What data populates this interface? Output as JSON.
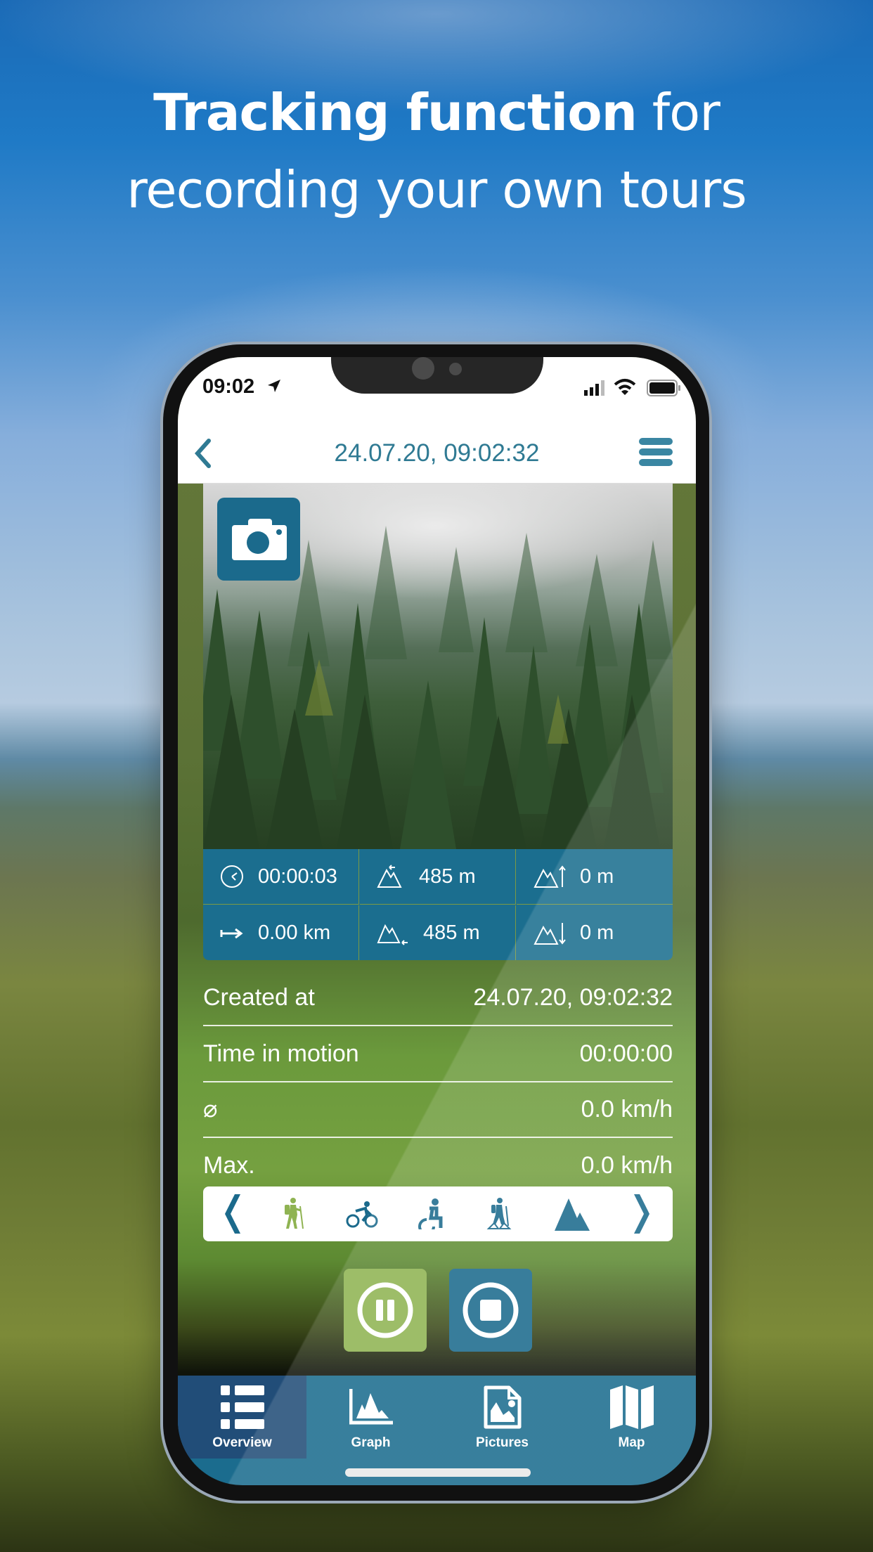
{
  "headline": {
    "line1_bold": "Tracking function",
    "line1_rest": " for",
    "line2": "recording your own tours"
  },
  "status_bar": {
    "time": "09:02",
    "icons": [
      "location-arrow-icon",
      "signal-icon",
      "wifi-icon",
      "battery-icon"
    ]
  },
  "nav": {
    "title": "24.07.20, 09:02:32",
    "back_icon": "chevron-left-icon",
    "menu_icon": "hamburger-menu-icon"
  },
  "photo": {
    "description": "misty pine forest",
    "camera_icon": "camera-icon"
  },
  "stats": [
    {
      "icon": "clock-icon",
      "value": "00:00:03"
    },
    {
      "icon": "altitude-start-icon",
      "value": "485 m"
    },
    {
      "icon": "ascent-icon",
      "value": "0 m"
    },
    {
      "icon": "distance-arrow-icon",
      "value": "0.00 km"
    },
    {
      "icon": "altitude-end-icon",
      "value": "485 m"
    },
    {
      "icon": "descent-icon",
      "value": "0 m"
    }
  ],
  "info": [
    {
      "label": "Created at",
      "value": "24.07.20, 09:02:32"
    },
    {
      "label": "Time in motion",
      "value": "00:00:00"
    },
    {
      "label": "⌀",
      "value": "0.0 km/h"
    },
    {
      "label": "Max.",
      "value": "0.0 km/h"
    }
  ],
  "activities": {
    "prev_icon": "chevron-left-icon",
    "next_icon": "chevron-right-icon",
    "items": [
      {
        "name": "hiking",
        "icon": "hiker-icon",
        "selected": true
      },
      {
        "name": "cycling",
        "icon": "cyclist-icon",
        "selected": false
      },
      {
        "name": "wheelchair",
        "icon": "wheelchair-icon",
        "selected": false
      },
      {
        "name": "snowshoe",
        "icon": "snowshoe-hiker-icon",
        "selected": false
      },
      {
        "name": "mountain",
        "icon": "mountain-icon",
        "selected": false
      }
    ]
  },
  "controls": {
    "pause_icon": "pause-icon",
    "stop_icon": "stop-icon"
  },
  "tabs": [
    {
      "label": "Overview",
      "icon": "list-icon",
      "active": true
    },
    {
      "label": "Graph",
      "icon": "chart-icon",
      "active": false
    },
    {
      "label": "Pictures",
      "icon": "image-file-icon",
      "active": false
    },
    {
      "label": "Map",
      "icon": "map-icon",
      "active": false
    }
  ],
  "colors": {
    "primary": "#1b6a8c",
    "accent_green": "#8fb352",
    "active_tab": "#214d78",
    "title_text": "#2f7a93"
  }
}
